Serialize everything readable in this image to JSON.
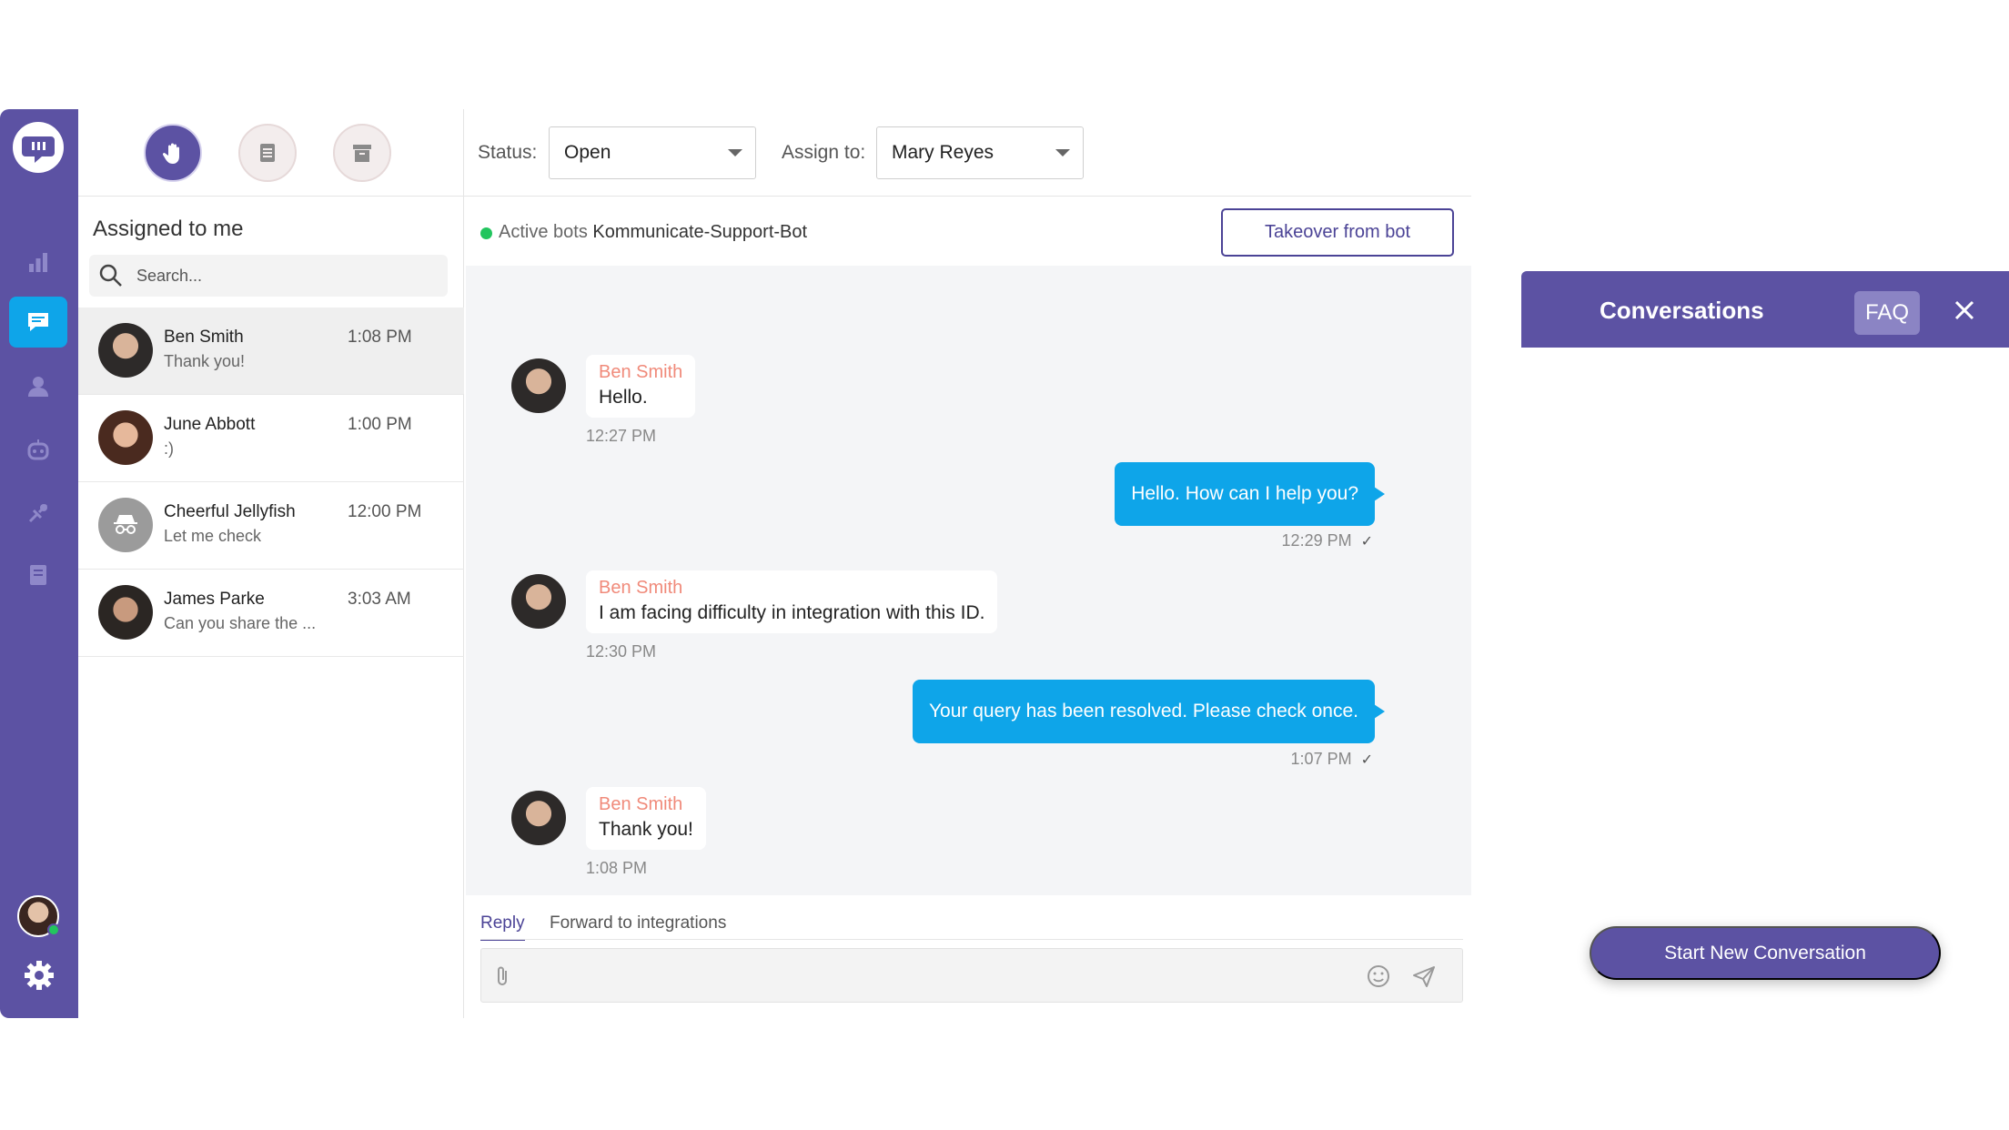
{
  "sidebar": {
    "items": [
      {
        "icon": "logo-icon"
      },
      {
        "icon": "bar-chart-icon"
      },
      {
        "icon": "conversations-icon",
        "active": true
      },
      {
        "icon": "users-icon"
      },
      {
        "icon": "bot-icon"
      },
      {
        "icon": "integrations-icon"
      },
      {
        "icon": "knowledge-base-icon"
      },
      {
        "icon": "gear-icon"
      }
    ],
    "status": "online"
  },
  "list_panel": {
    "filters": [
      {
        "icon": "hand-icon",
        "active": true
      },
      {
        "icon": "document-icon",
        "active": false
      },
      {
        "icon": "archive-icon",
        "active": false
      }
    ],
    "title": "Assigned to me",
    "search_placeholder": "Search...",
    "conversations": [
      {
        "name": "Ben Smith",
        "time": "1:08 PM",
        "preview": "Thank you!",
        "selected": true
      },
      {
        "name": "June Abbott",
        "time": "1:00 PM",
        "preview": ":)"
      },
      {
        "name": "Cheerful Jellyfish",
        "time": "12:00 PM",
        "preview": "Let me check"
      },
      {
        "name": "James Parke",
        "time": "3:03 AM",
        "preview": "Can you share the ..."
      }
    ]
  },
  "chat_header": {
    "status_label": "Status:",
    "status_value": "Open",
    "assign_label": "Assign to:",
    "assign_value": "Mary Reyes"
  },
  "bot_bar": {
    "prefix": "Active bots",
    "bot_name": "Kommunicate-Support-Bot",
    "takeover_label": "Takeover from bot"
  },
  "messages": [
    {
      "direction": "in",
      "sender": "Ben Smith",
      "text": "Hello.",
      "time": "12:27 PM"
    },
    {
      "direction": "out",
      "text": "Hello. How can I help you?",
      "time": "12:29 PM",
      "check": "✓"
    },
    {
      "direction": "in",
      "sender": "Ben Smith",
      "text": "I am facing difficulty in integration with this ID.",
      "time": "12:30 PM"
    },
    {
      "direction": "out",
      "text": "Your query has been resolved. Please check once.",
      "time": "1:07 PM",
      "check": "✓"
    },
    {
      "direction": "in",
      "sender": "Ben Smith",
      "text": "Thank you!",
      "time": "1:08 PM"
    }
  ],
  "reply": {
    "tabs": [
      "Reply",
      "Forward to integrations"
    ],
    "active_tab": "Reply",
    "value": ""
  },
  "widget": {
    "title": "Conversations",
    "faq_label": "FAQ",
    "start_label": "Start New Conversation"
  },
  "colors": {
    "brand": "#5c52a3",
    "accent": "#0ea5e9",
    "online": "#22c55e",
    "sender_name": "#f08a7a"
  }
}
